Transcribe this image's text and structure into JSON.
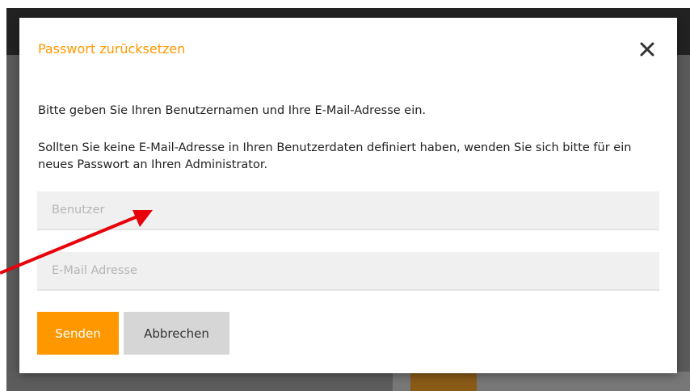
{
  "dialog": {
    "title": "Passwort zurücksetzen",
    "close_icon": "close-icon",
    "instruction": "Bitte geben Sie Ihren Benutzernamen und Ihre E-Mail-Adresse ein.",
    "note": "Sollten Sie keine E-Mail-Adresse in Ihren Benutzerdaten definiert haben, wenden Sie sich bitte für ein neues Passwort an Ihren Administrator.",
    "fields": {
      "user": {
        "placeholder": "Benutzer",
        "value": ""
      },
      "email": {
        "placeholder": "E-Mail Adresse",
        "value": ""
      }
    },
    "buttons": {
      "send": "Senden",
      "cancel": "Abbrechen"
    }
  },
  "annotation": {
    "icon": "red-arrow-icon",
    "color": "#e8000b"
  },
  "colors": {
    "accent": "#ff9800",
    "cancel_bg": "#d6d6d6",
    "field_bg": "#f0f0f0"
  }
}
